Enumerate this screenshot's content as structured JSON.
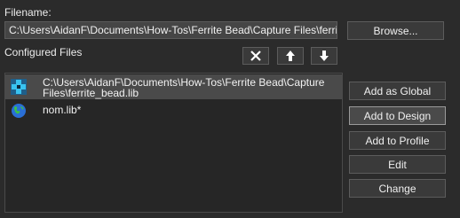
{
  "filename": {
    "label": "Filename:",
    "value": "C:\\Users\\AidanF\\Documents\\How-Tos\\Ferrite Bead\\Capture Files\\ferrit",
    "browse_label": "Browse..."
  },
  "configured": {
    "label": "Configured Files",
    "items": [
      {
        "line1": "C:\\Users\\AidanF\\Documents\\How-Tos\\Ferrite Bead\\Capture",
        "line2": "Files\\ferrite_bead.lib",
        "icon": "design-library-icon",
        "selected": true
      },
      {
        "line1": "nom.lib*",
        "line2": "",
        "icon": "globe-library-icon",
        "selected": false
      }
    ]
  },
  "buttons": {
    "add_global": "Add as Global",
    "add_design": "Add to Design",
    "add_profile": "Add to Profile",
    "edit": "Edit",
    "change": "Change"
  },
  "icons": {
    "delete": "close-icon",
    "move_up": "arrow-up-icon",
    "move_down": "arrow-down-icon"
  }
}
